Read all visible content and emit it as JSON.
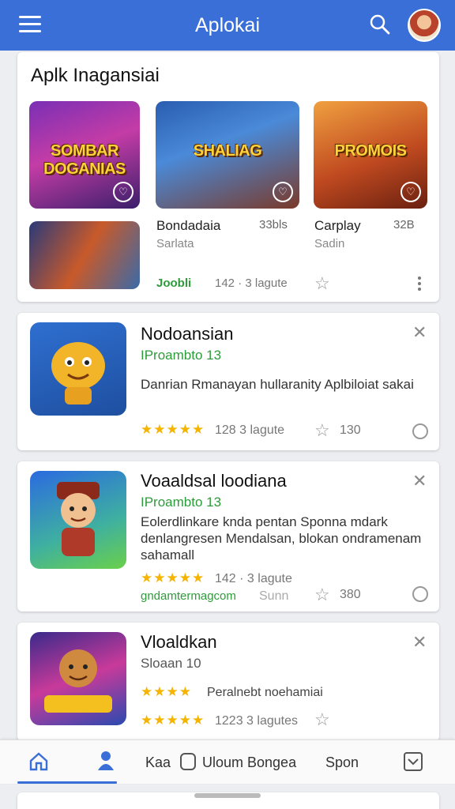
{
  "app_title": "Aplokai",
  "icons": {
    "menu": "menu-icon",
    "search": "search-icon",
    "avatar": "user-avatar"
  },
  "featured": {
    "heading": "Aplk Inagansiai",
    "tiles": [
      {
        "label": "SOMBAR DOGANIAS"
      },
      {
        "label": "SHALIAG"
      },
      {
        "label": "PROMOIS"
      }
    ],
    "items": [
      {
        "name": "Bondadaia",
        "sub": "Sarlata",
        "size": "33bls"
      },
      {
        "name": "Carplay",
        "sub": "Sadin",
        "size": "32B"
      }
    ],
    "green": "Joobli",
    "meta": "142 · 3 lagute"
  },
  "apps": [
    {
      "title": "Nodoansian",
      "sub": "IProambto 13",
      "desc": "Danrian Rmanayan hullaranity Aplbiloiat sakai",
      "stars": "★★★★★",
      "rating": "128 3 lagute",
      "count": "130"
    },
    {
      "title": "Voaaldsal loodiana",
      "sub": "IProambto 13",
      "desc": "Eolerdlinkare knda pentan Sponna mdark denlangresen Mendalsan, blokan ondramenam sahamall",
      "stars": "★★★★★",
      "rating": "142 · 3 lagute",
      "link": "gndamtermagcom",
      "extra": "Sunn",
      "count": "380"
    },
    {
      "title": "Vloaldkan",
      "sub": "Sloaan 10",
      "stars_top": "★★★★",
      "note": "Peralnebt noehamiai",
      "stars": "★★★★★",
      "rating": "1223 3 lagutes"
    }
  ],
  "bottom_nav": {
    "items": [
      "Kaa",
      "Uloum Bongea",
      "Spon"
    ]
  },
  "colors": {
    "accent": "#3a6fd8",
    "green": "#2e9b3a",
    "star": "#f4b400"
  }
}
